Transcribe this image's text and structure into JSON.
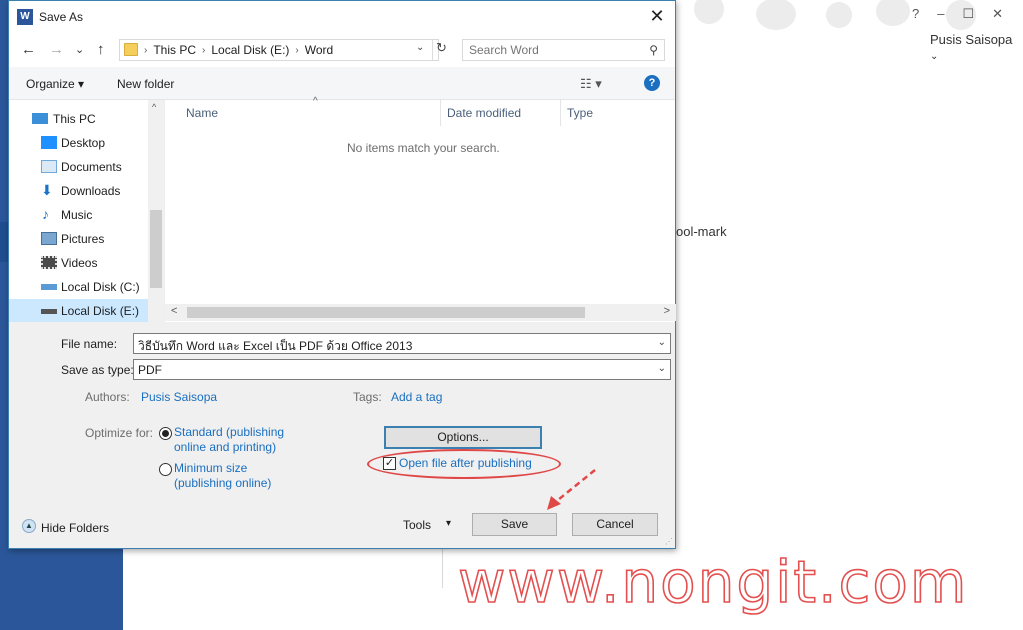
{
  "background": {
    "user_name": "Pusis Saisopa",
    "partial_text": "ool-mark",
    "window_controls": [
      "?",
      "–",
      "☐",
      "✕"
    ],
    "watermark": "www.nongit.com"
  },
  "dialog": {
    "title": "Save As",
    "app_icon_letter": "W",
    "close_glyph": "✕",
    "nav": {
      "back": "←",
      "forward": "→",
      "recent": "⌄",
      "up": "↑"
    },
    "breadcrumbs": [
      "This PC",
      "Local Disk (E:)",
      "Word"
    ],
    "breadcrumb_sep": "›",
    "address_dropdown": "⌄",
    "refresh": "↻",
    "search_placeholder": "Search Word",
    "search_icon": "⚲",
    "toolbar": {
      "organize": "Organize ▾",
      "new_folder": "New folder",
      "view": "☷ ▾",
      "help": "?"
    },
    "nav_items": [
      {
        "label": "This PC",
        "icon": "computer-icon",
        "color": "#3a8fd8",
        "level": 0
      },
      {
        "label": "Desktop",
        "icon": "desktop-icon",
        "color": "#1e90ff",
        "level": 1
      },
      {
        "label": "Documents",
        "icon": "documents-icon",
        "color": "#6fa8dc",
        "level": 1
      },
      {
        "label": "Downloads",
        "icon": "downloads-icon",
        "color": "#1a73c8",
        "level": 1
      },
      {
        "label": "Music",
        "icon": "music-icon",
        "color": "#1a73c8",
        "level": 1
      },
      {
        "label": "Pictures",
        "icon": "pictures-icon",
        "color": "#7aa7cf",
        "level": 1
      },
      {
        "label": "Videos",
        "icon": "videos-icon",
        "color": "#4a4a4a",
        "level": 1
      },
      {
        "label": "Local Disk (C:)",
        "icon": "drive-c-icon",
        "color": "#5b9bd5",
        "level": 1
      },
      {
        "label": "Local Disk (E:)",
        "icon": "drive-e-icon",
        "color": "#555555",
        "level": 1,
        "selected": true
      }
    ],
    "columns": [
      "Name",
      "Date modified",
      "Type"
    ],
    "sort_arrow": "^",
    "empty_message": "No items match your search.",
    "scroll": {
      "left": "<",
      "right": ">",
      "up": "^",
      "down": "v"
    },
    "form": {
      "file_name_label": "File name:",
      "file_name_value": "วิธีบันทึก Word และ Excel เป็น PDF ด้วย Office 2013",
      "save_type_label": "Save as type:",
      "save_type_value": "PDF",
      "dropdown_glyph": "⌄",
      "authors_label": "Authors:",
      "authors_value": "Pusis Saisopa",
      "tags_label": "Tags:",
      "tags_value": "Add a tag",
      "optimize_label": "Optimize for:",
      "standard_line1": "Standard (publishing",
      "standard_line2": "online and printing)",
      "minimum_line1": "Minimum size",
      "minimum_line2": "(publishing online)",
      "options_button": "Options...",
      "open_after_label": "Open file after publishing",
      "open_after_checked": true,
      "check_glyph": "✓",
      "hide_folders": "Hide Folders",
      "hide_glyph": "▲",
      "tools_label": "Tools",
      "tools_glyph": "▾",
      "save_button": "Save",
      "cancel_button": "Cancel",
      "grip": "⋰"
    },
    "accent_color": "#1a6fc0",
    "annotation_color": "#e04848"
  }
}
